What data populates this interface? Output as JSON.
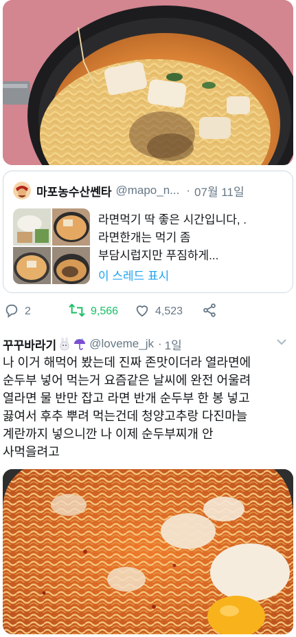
{
  "quoted_tweet": {
    "display_name": "마포농수산쎈타",
    "handle": "@mapo_n...",
    "separator": "·",
    "date": "07월 11일",
    "text_lines": [
      "라면먹기 딱 좋은 시간입니다, .",
      "라면한개는 먹기 좀",
      "부담시럽지만 푸짐하게..."
    ],
    "show_thread": "이 스레드 표시"
  },
  "actions": {
    "reply_count": "2",
    "retweet_count": "9,566",
    "like_count": "4,523",
    "reply_icon": "reply-icon",
    "retweet_icon": "retweet-icon",
    "like_icon": "heart-icon",
    "share_icon": "share-icon",
    "retweet_color": "#17bf63"
  },
  "reply_tweet": {
    "display_name": "꾸꾸바라기",
    "name_emojis": [
      "rabbit-emoji",
      "umbrella-emoji"
    ],
    "handle": "@loveme_jk",
    "separator": "·",
    "date": "1일",
    "text_lines": [
      "나 이거 해먹어 봤는데 진짜 존맛이더라 열라면에",
      "순두부 넣어 먹는거 요즘같은 날씨에 완전 어울려",
      "열라면 물 반만 잡고 라면 반개 순두부 한 봉 넣고",
      "끓여서 후추 뿌려 먹는건데 청양고추랑 다진마늘",
      "계란까지 넣으니깐 나 이제 순두부찌개 안",
      "사먹을려고"
    ]
  },
  "colors": {
    "text": "#14171a",
    "secondary": "#657786",
    "link": "#1da1f2",
    "border": "#cfd9de"
  }
}
